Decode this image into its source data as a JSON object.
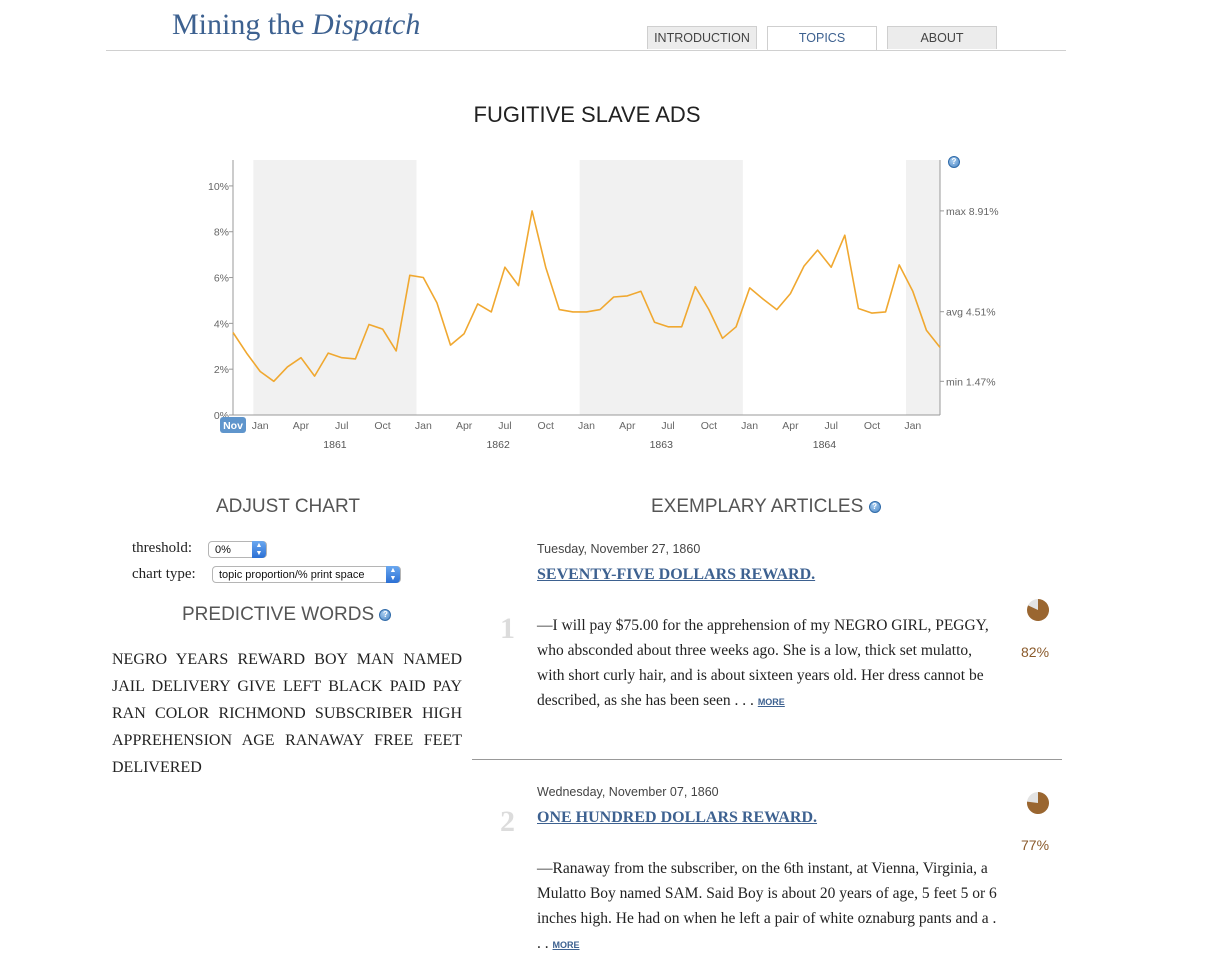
{
  "header": {
    "title_main": "Mining the ",
    "title_italic": "Dispatch",
    "tabs": [
      {
        "label": "INTRODUCTION"
      },
      {
        "label": "TOPICS"
      },
      {
        "label": "ABOUT"
      }
    ],
    "active_tab": "TOPICS"
  },
  "chart_title": "FUGITIVE SLAVE ADS",
  "chart_data": {
    "type": "line",
    "title": "FUGITIVE SLAVE ADS",
    "xlabel": "",
    "ylabel": "",
    "ylim": [
      0,
      11
    ],
    "grid": false,
    "y_ticks": [
      "0%",
      "2%",
      "4%",
      "6%",
      "8%",
      "10%"
    ],
    "x_ticks": [
      "Nov",
      "Jan",
      "Apr",
      "Jul",
      "Oct",
      "Jan",
      "Apr",
      "Jul",
      "Oct",
      "Jan",
      "Apr",
      "Jul",
      "Oct",
      "Jan",
      "Apr",
      "Jul",
      "Oct",
      "Jan"
    ],
    "years": [
      "1861",
      "1862",
      "1863",
      "1864"
    ],
    "stats": {
      "max": "max 8.91%",
      "avg": "avg 4.51%",
      "min": "min 1.47%"
    },
    "color": "#f0a830",
    "series": [
      {
        "x": [
          "1860-11",
          "1860-12",
          "1861-01",
          "1861-02",
          "1861-03",
          "1861-04",
          "1861-05",
          "1861-06",
          "1861-07",
          "1861-08",
          "1861-09",
          "1861-10",
          "1861-11",
          "1861-12",
          "1862-01",
          "1862-02",
          "1862-03",
          "1862-04",
          "1862-05",
          "1862-06",
          "1862-07",
          "1862-08",
          "1862-09",
          "1862-10",
          "1862-11",
          "1862-12",
          "1863-01",
          "1863-02",
          "1863-03",
          "1863-04",
          "1863-05",
          "1863-06",
          "1863-07",
          "1863-08",
          "1863-09",
          "1863-10",
          "1863-11",
          "1863-12",
          "1864-01",
          "1864-02",
          "1864-03",
          "1864-04",
          "1864-05",
          "1864-06",
          "1864-07",
          "1864-08",
          "1864-09",
          "1864-10",
          "1864-11",
          "1864-12",
          "1865-01",
          "1865-02",
          "1865-03"
        ],
        "values": [
          3.6,
          2.7,
          1.9,
          1.47,
          2.1,
          2.5,
          1.7,
          2.7,
          2.5,
          2.45,
          3.95,
          3.75,
          2.8,
          6.1,
          6.0,
          4.9,
          3.05,
          3.55,
          4.85,
          4.5,
          6.45,
          5.65,
          8.91,
          6.45,
          4.6,
          4.5,
          4.5,
          4.6,
          5.15,
          5.2,
          5.4,
          4.05,
          3.85,
          3.85,
          5.6,
          4.6,
          3.35,
          3.85,
          5.55,
          5.05,
          4.6,
          5.3,
          6.5,
          7.2,
          6.45,
          7.85,
          4.65,
          4.45,
          4.5,
          6.55,
          5.4,
          3.7,
          2.95
        ]
      }
    ],
    "shaded_periods": [
      [
        "1861-01",
        "1861-12"
      ],
      [
        "1863-01",
        "1863-12"
      ],
      [
        "1865-01",
        "1865-03"
      ]
    ]
  },
  "adjust": {
    "heading": "ADJUST CHART",
    "threshold_label": "threshold:",
    "threshold_value": "0%",
    "chart_type_label": "chart type:",
    "chart_type_value": "topic proportion/% print space"
  },
  "predictive": {
    "heading": "PREDICTIVE WORDS",
    "words": "NEGRO YEARS REWARD BOY MAN NAMED JAIL DELIVERY GIVE LEFT BLACK PAID PAY RAN COLOR RICHMOND SUBSCRIBER HIGH APPREHENSION AGE RANAWAY FREE FEET DELIVERED"
  },
  "exemplary": {
    "heading": "EXEMPLARY ARTICLES",
    "more_label": "MORE",
    "pie_color": "#9a6630",
    "articles": [
      {
        "rank": "1",
        "date": "Tuesday, November 27, 1860",
        "title": "SEVENTY-FIVE DOLLARS REWARD.",
        "body": "—I will pay $75.00 for the apprehension of my NEGRO GIRL, PEGGY, who absconded about three weeks ago. She is a low, thick set mulatto, with short curly hair, and is about sixteen years old. Her dress cannot be described, as she has been seen . . .",
        "percent": "82%",
        "fraction": 0.82
      },
      {
        "rank": "2",
        "date": "Wednesday, November 07, 1860",
        "title": "ONE HUNDRED DOLLARS REWARD.",
        "body": "—Ranaway from the subscriber, on the 6th instant, at Vienna, Virginia, a Mulatto Boy named SAM. Said Boy is about 20 years of age, 5 feet 5 or 6 inches high. He had on when he left a pair of white oznaburg pants and a . . .",
        "percent": "77%",
        "fraction": 0.77
      }
    ]
  }
}
